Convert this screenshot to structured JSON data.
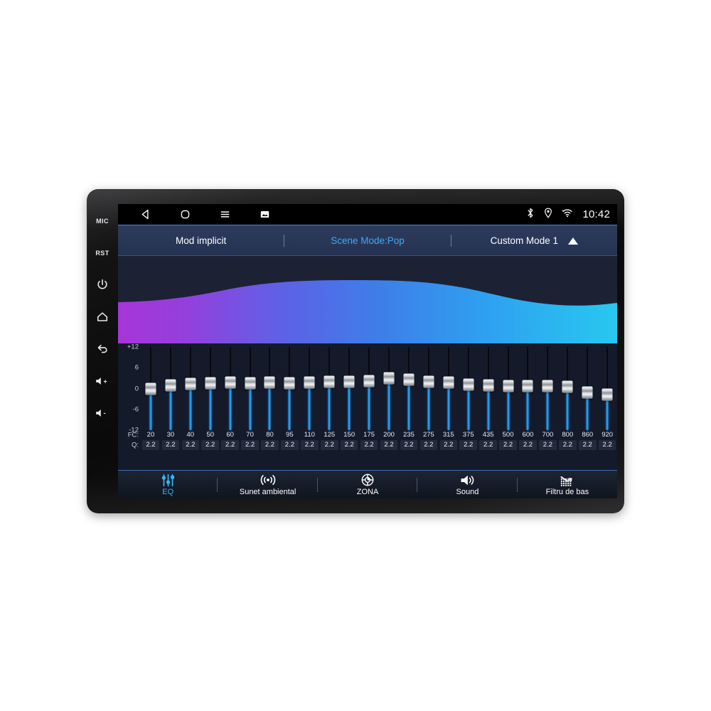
{
  "device": {
    "hardware_keys": [
      {
        "name": "mic-key",
        "label": "MIC",
        "type": "text"
      },
      {
        "name": "reset-key",
        "label": "RST",
        "type": "text"
      },
      {
        "name": "power-key",
        "label": "",
        "type": "power"
      },
      {
        "name": "home-key",
        "label": "",
        "type": "home"
      },
      {
        "name": "back-key",
        "label": "",
        "type": "back"
      },
      {
        "name": "volume-up-key",
        "label": "",
        "type": "vol-up"
      },
      {
        "name": "volume-down-key",
        "label": "",
        "type": "vol-down"
      }
    ]
  },
  "statusbar": {
    "nav": [
      {
        "name": "nav-back-icon",
        "icon": "back-triangle"
      },
      {
        "name": "nav-home-icon",
        "icon": "home-rounded-square"
      },
      {
        "name": "nav-menu-icon",
        "icon": "hamburger"
      },
      {
        "name": "nav-screenshot-icon",
        "icon": "screenshot"
      }
    ],
    "icons": [
      {
        "name": "bluetooth-icon",
        "icon": "bluetooth"
      },
      {
        "name": "location-icon",
        "icon": "location-pin"
      },
      {
        "name": "wifi-icon",
        "icon": "wifi"
      }
    ],
    "clock": "10:42"
  },
  "modebar": {
    "default_mode": "Mod implicit",
    "scene_mode": "Scene Mode:Pop",
    "custom_mode": "Custom Mode 1",
    "accent_color": "#3fa9f5",
    "expand_icon": "caret-up"
  },
  "wave": {
    "gradient_start": "#a735d8",
    "gradient_mid": "#3f7de8",
    "gradient_end": "#28c8f0",
    "background": "#1c2233"
  },
  "equalizer": {
    "y_ticks": [
      "+12",
      "6",
      "0",
      "-6",
      "-12"
    ],
    "row_label_fc": "FC:",
    "row_label_q": "Q:",
    "db_range": [
      -12,
      12
    ],
    "track_color": "#1f9bf0",
    "bands": [
      {
        "fc": "20",
        "q": "2.2",
        "gain": 0.0
      },
      {
        "fc": "30",
        "q": "2.2",
        "gain": 0.9
      },
      {
        "fc": "40",
        "q": "2.2",
        "gain": 1.3
      },
      {
        "fc": "50",
        "q": "2.2",
        "gain": 1.6
      },
      {
        "fc": "60",
        "q": "2.2",
        "gain": 1.7
      },
      {
        "fc": "70",
        "q": "2.2",
        "gain": 1.5
      },
      {
        "fc": "80",
        "q": "2.2",
        "gain": 1.7
      },
      {
        "fc": "95",
        "q": "2.2",
        "gain": 1.6
      },
      {
        "fc": "110",
        "q": "2.2",
        "gain": 1.7
      },
      {
        "fc": "125",
        "q": "2.2",
        "gain": 1.9
      },
      {
        "fc": "150",
        "q": "2.2",
        "gain": 2.0
      },
      {
        "fc": "175",
        "q": "2.2",
        "gain": 2.1
      },
      {
        "fc": "200",
        "q": "2.2",
        "gain": 2.9
      },
      {
        "fc": "235",
        "q": "2.2",
        "gain": 2.6
      },
      {
        "fc": "275",
        "q": "2.2",
        "gain": 1.9
      },
      {
        "fc": "315",
        "q": "2.2",
        "gain": 1.7
      },
      {
        "fc": "375",
        "q": "2.2",
        "gain": 1.2
      },
      {
        "fc": "435",
        "q": "2.2",
        "gain": 0.9
      },
      {
        "fc": "500",
        "q": "2.2",
        "gain": 0.8
      },
      {
        "fc": "600",
        "q": "2.2",
        "gain": 0.8
      },
      {
        "fc": "700",
        "q": "2.2",
        "gain": 0.7
      },
      {
        "fc": "800",
        "q": "2.2",
        "gain": 0.6
      },
      {
        "fc": "860",
        "q": "2.2",
        "gain": -1.1
      },
      {
        "fc": "920",
        "q": "2.2",
        "gain": -1.8
      }
    ]
  },
  "tabs": [
    {
      "name": "tab-eq",
      "label": "EQ",
      "icon": "eq-sliders-icon",
      "active": true
    },
    {
      "name": "tab-surround",
      "label": "Sunet ambiental",
      "icon": "surround-icon",
      "active": false
    },
    {
      "name": "tab-zone",
      "label": "ZONA",
      "icon": "zone-target-icon",
      "active": false
    },
    {
      "name": "tab-sound",
      "label": "Sound",
      "icon": "speaker-icon",
      "active": false
    },
    {
      "name": "tab-bass-filter",
      "label": "Filtru de bas",
      "icon": "bass-filter-icon",
      "active": false
    }
  ]
}
